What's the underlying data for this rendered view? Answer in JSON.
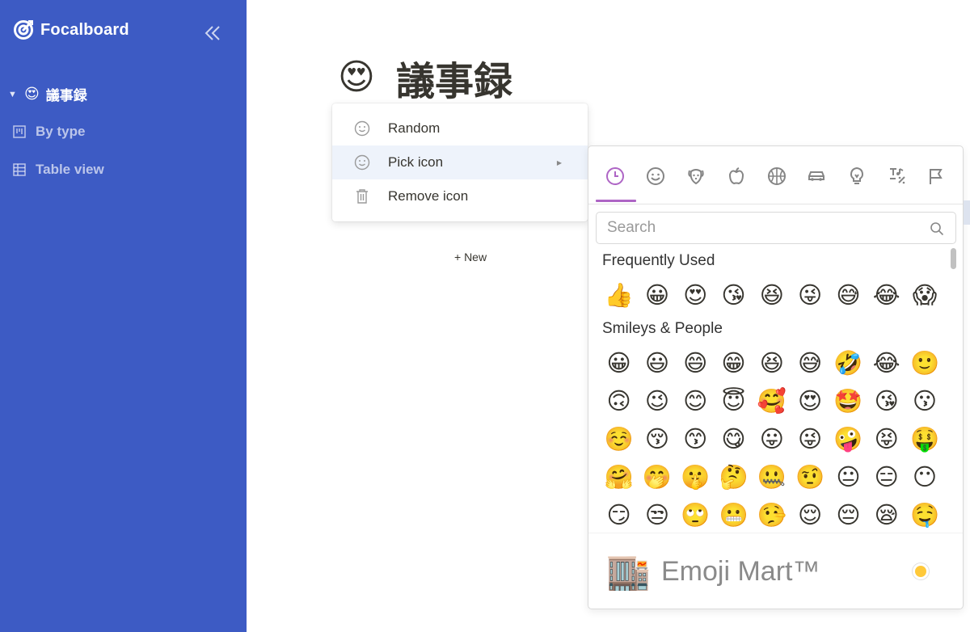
{
  "app": {
    "name": "Focalboard"
  },
  "sidebar": {
    "board": {
      "icon": "😍",
      "name": "議事録"
    },
    "views": [
      {
        "name": "By type",
        "icon": "board-view-icon"
      },
      {
        "name": "Table view",
        "icon": "table-view-icon"
      }
    ]
  },
  "board": {
    "icon": "😍",
    "title": "議事録",
    "new_label": "+ New"
  },
  "icon_menu": {
    "items": [
      {
        "label": "Random",
        "icon": "smiley-icon"
      },
      {
        "label": "Pick icon",
        "icon": "smiley-icon",
        "submenu": true
      },
      {
        "label": "Remove icon",
        "icon": "trash-icon"
      }
    ]
  },
  "emoji_picker": {
    "categories": [
      "recent",
      "smileys",
      "animals",
      "food",
      "activity",
      "travel",
      "objects",
      "symbols",
      "flags"
    ],
    "active_category": "recent",
    "search": {
      "placeholder": "Search",
      "value": ""
    },
    "sections": [
      {
        "label": "Frequently Used",
        "emojis": [
          "👍",
          "😀",
          "😍",
          "😘",
          "😆",
          "😜",
          "😅",
          "😂",
          "😱"
        ]
      },
      {
        "label": "Smileys & People",
        "emojis": [
          [
            "😀",
            "😃",
            "😄",
            "😁",
            "😆",
            "😅",
            "🤣",
            "😂",
            "🙂"
          ],
          [
            "🙃",
            "😉",
            "😊",
            "😇",
            "🥰",
            "😍",
            "🤩",
            "😘",
            "😗"
          ],
          [
            "☺️",
            "😚",
            "😙",
            "😋",
            "😛",
            "😜",
            "🤪",
            "😝",
            "🤑"
          ],
          [
            "🤗",
            "🤭",
            "🤫",
            "🤔",
            "🤐",
            "🤨",
            "😐",
            "😑",
            "😶"
          ],
          [
            "😏",
            "😒",
            "🙄",
            "😬",
            "🤥",
            "😌",
            "😔",
            "😪",
            "🤤"
          ]
        ]
      }
    ],
    "footer": {
      "emoji": "🏬",
      "text": "Emoji Mart™",
      "skin_tone_color": "#ffc93a"
    }
  }
}
